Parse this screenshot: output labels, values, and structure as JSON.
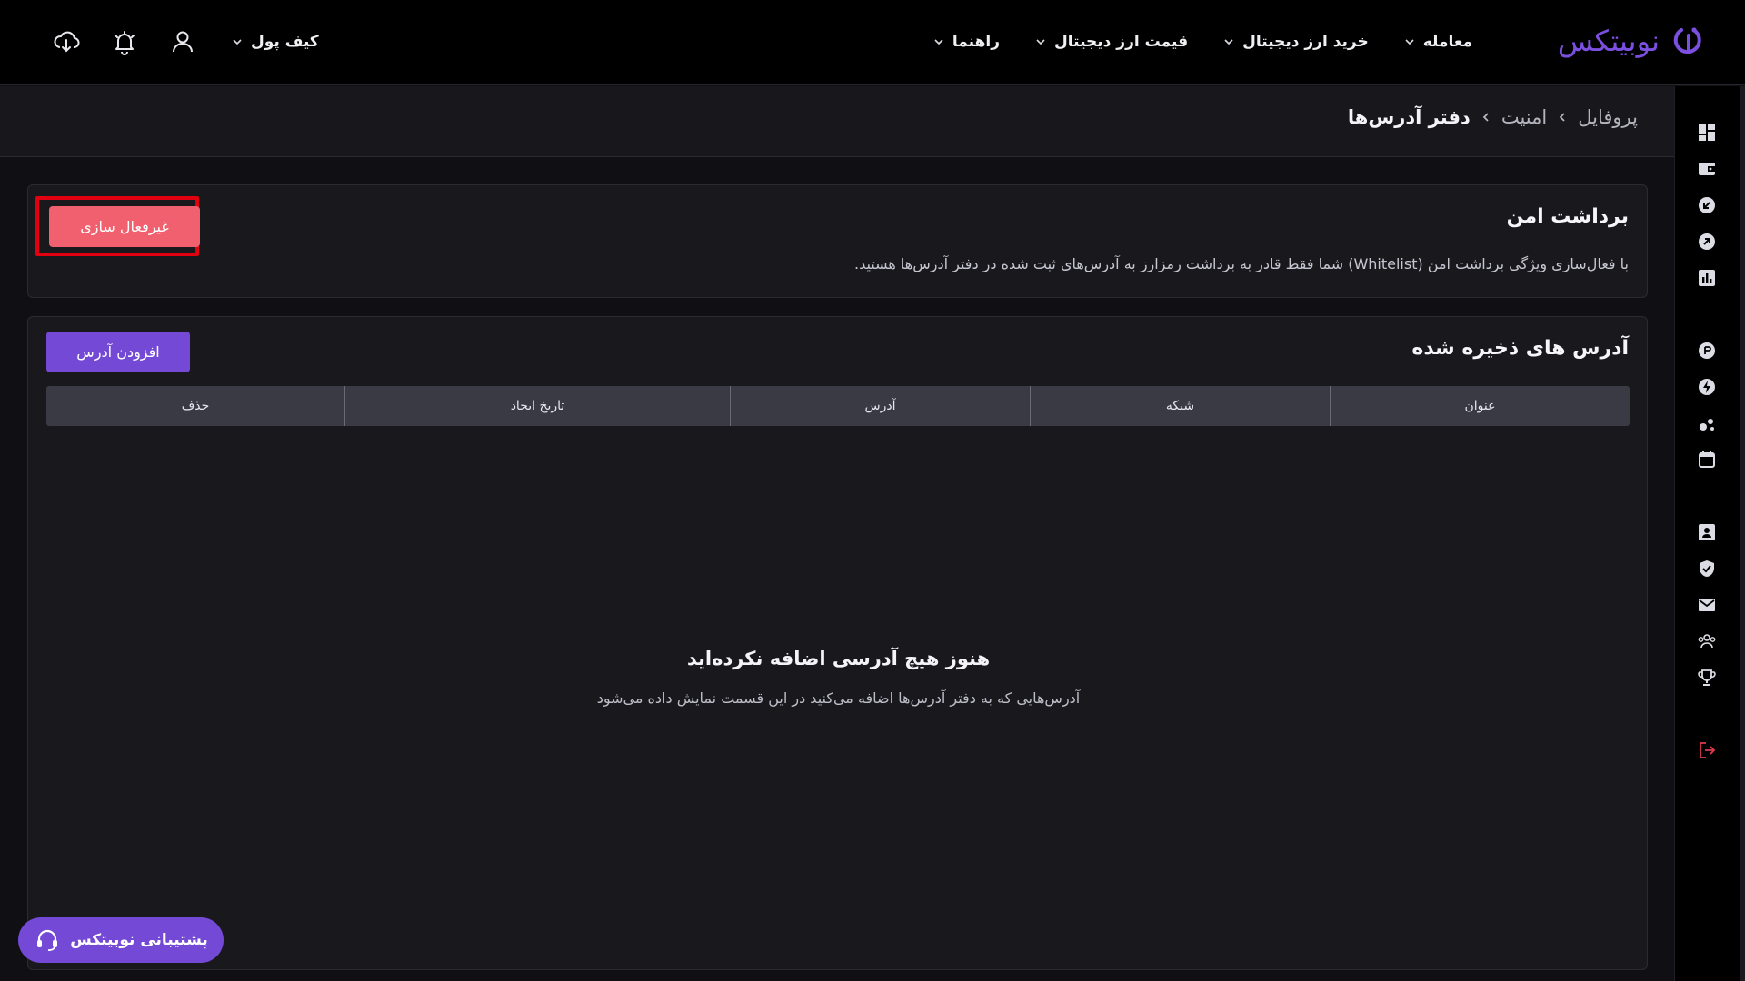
{
  "header": {
    "logo_text": "نوبیتکس",
    "nav": [
      {
        "label": "معامله"
      },
      {
        "label": "خرید ارز دیجیتال"
      },
      {
        "label": "قیمت ارز دیجیتال"
      },
      {
        "label": "راهنما"
      }
    ],
    "wallet_label": "کیف پول"
  },
  "breadcrumb": {
    "items": [
      "پروفایل",
      "امنیت",
      "دفتر آدرس‌ها"
    ]
  },
  "secure_withdraw": {
    "title": "برداشت امن",
    "description": "با فعال‌سازی ویژگی برداشت امن (Whitelist) شما فقط قادر به برداشت رمزارز به آدرس‌های ثبت شده در دفتر آدرس‌ها هستید.",
    "deactivate_label": "غیرفعال سازی"
  },
  "saved_addresses": {
    "title": "آدرس های ذخیره شده",
    "add_label": "افزودن آدرس",
    "columns": [
      "عنوان",
      "شبکه",
      "آدرس",
      "تاریخ ایجاد",
      "حذف"
    ],
    "empty_title": "هنوز هیچ آدرسی اضافه نکرده‌اید",
    "empty_sub": "آدرس‌هایی که به دفتر آدرس‌ها اضافه می‌کنید در این قسمت نمایش داده می‌شود"
  },
  "support": {
    "label": "پشتیبانی نوبیتکس"
  },
  "colors": {
    "brand": "#7449d6",
    "danger": "#f0606e",
    "highlight": "#e0000f"
  }
}
